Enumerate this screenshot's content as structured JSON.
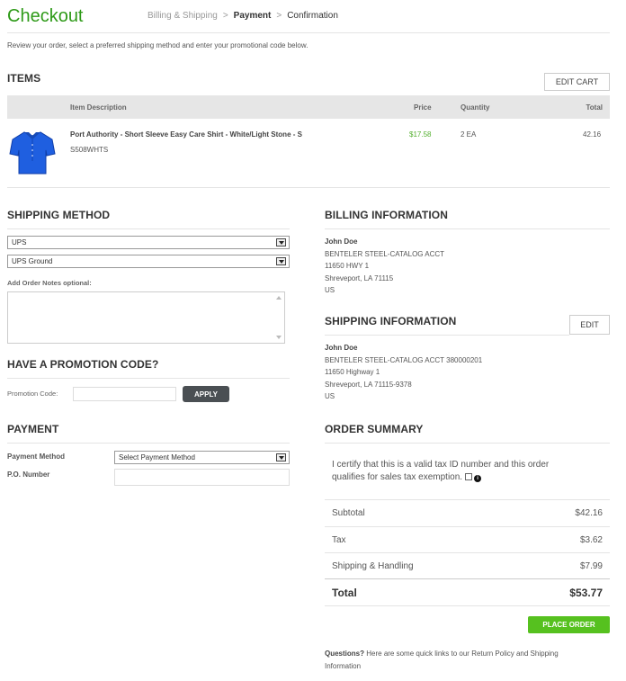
{
  "header": {
    "title": "Checkout",
    "steps": [
      "Billing & Shipping",
      ">",
      "Payment",
      ">",
      "Confirmation"
    ]
  },
  "intro": "Review your order, select a preferred shipping method and enter your promotional code below.",
  "items": {
    "heading": "ITEMS",
    "edit_cart": "EDIT CART",
    "columns": {
      "description": "Item Description",
      "price": "Price",
      "quantity": "Quantity",
      "total": "Total"
    },
    "rows": [
      {
        "description": "Port Authority - Short Sleeve Easy Care Shirt - White/Light Stone - S",
        "sku": "S508WHTS",
        "price": "$17.58",
        "quantity": "2 EA",
        "total": "42.16"
      }
    ]
  },
  "shipping_method": {
    "heading": "SHIPPING METHOD",
    "carrier": "UPS",
    "service": "UPS Ground",
    "notes_label": "Add Order Notes optional:"
  },
  "promo": {
    "heading": "HAVE A PROMOTION CODE?",
    "label": "Promotion Code:",
    "apply": "APPLY"
  },
  "payment": {
    "heading": "PAYMENT",
    "method_label": "Payment Method",
    "method_value": "Select Payment Method",
    "po_label": "P.O. Number"
  },
  "billing": {
    "heading": "BILLING INFORMATION",
    "name": "John Doe",
    "line1": "BENTELER STEEL-CATALOG ACCT",
    "line2": "11650 HWY 1",
    "line3": "Shreveport, LA 71115",
    "line4": "US"
  },
  "shipping_info": {
    "heading": "SHIPPING INFORMATION",
    "edit": "EDIT",
    "name": "John Doe",
    "line1": "BENTELER STEEL-CATALOG ACCT 380000201",
    "line2": "11650 Highway 1",
    "line3": "Shreveport, LA 71115-9378",
    "line4": "US"
  },
  "summary": {
    "heading": "ORDER SUMMARY",
    "tax_cert_line1": "I certify that this is a valid tax ID number and this order",
    "tax_cert_line2": "qualifies for sales tax exemption.",
    "subtotal_label": "Subtotal",
    "subtotal": "$42.16",
    "tax_label": "Tax",
    "tax": "$3.62",
    "shipping_label": "Shipping & Handling",
    "shipping": "$7.99",
    "total_label": "Total",
    "total": "$53.77",
    "place_order": "PLACE ORDER"
  },
  "footer": {
    "questions_bold": "Questions?",
    "questions_text": "Here are some quick links to our Return Policy and Shipping",
    "questions_text2": "Information"
  },
  "colors": {
    "brand_green": "#2e9a18",
    "button_green": "#56c11f",
    "price_green": "#55b030",
    "dark_button": "#4a4f53"
  }
}
